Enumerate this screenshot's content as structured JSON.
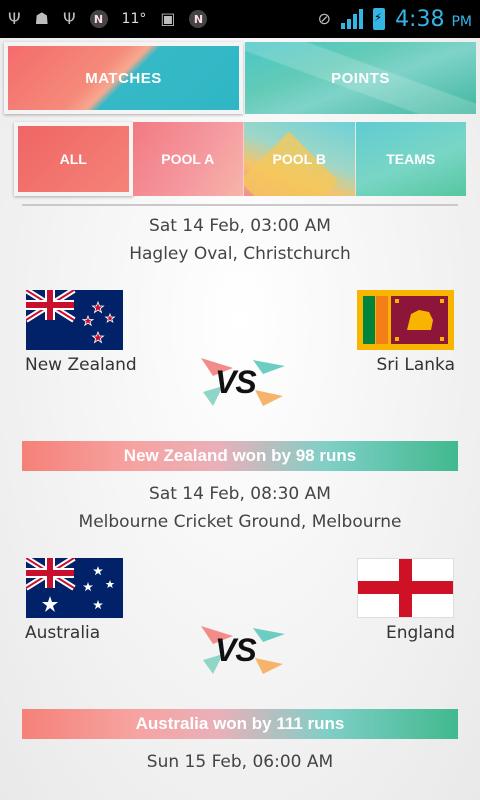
{
  "status_bar": {
    "temperature": "11°",
    "time": "4:38",
    "ampm": "PM",
    "accent_color": "#33b5e5"
  },
  "tabs_top": [
    {
      "label": "MATCHES",
      "selected": true
    },
    {
      "label": "POINTS",
      "selected": false
    }
  ],
  "tabs_sub": [
    {
      "label": "ALL",
      "selected": true
    },
    {
      "label": "POOL A",
      "selected": false
    },
    {
      "label": "POOL B",
      "selected": false
    },
    {
      "label": "TEAMS",
      "selected": false
    }
  ],
  "matches": [
    {
      "datetime": "Sat 14 Feb, 03:00 AM",
      "venue": "Hagley Oval, Christchurch",
      "team1": "New Zealand",
      "team2": "Sri Lanka",
      "vs": "VS",
      "result": "New Zealand won by 98 runs"
    },
    {
      "datetime": "Sat 14 Feb, 08:30 AM",
      "venue": "Melbourne Cricket Ground, Melbourne",
      "team1": "Australia",
      "team2": "England",
      "vs": "VS",
      "result": "Australia won by 111 runs"
    },
    {
      "datetime": "Sun 15 Feb, 06:00 AM"
    }
  ]
}
